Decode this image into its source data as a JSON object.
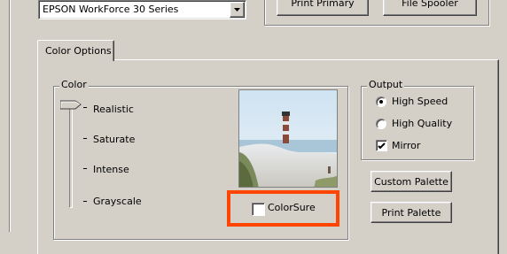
{
  "printer": {
    "selected": "EPSON WorkForce 30 Series"
  },
  "top_buttons": {
    "print_primary": "Print Primary",
    "file_spooler": "File Spooler"
  },
  "tab": {
    "label": "Color Options"
  },
  "color": {
    "legend": "Color",
    "levels": [
      "Realistic",
      "Saturate",
      "Intense",
      "Grayscale"
    ],
    "selected_level": "Realistic",
    "colorsure_label": "ColorSure",
    "colorsure_checked": false
  },
  "output": {
    "legend": "Output",
    "options": [
      "High Speed",
      "High Quality"
    ],
    "selected": "High Speed",
    "mirror_label": "Mirror",
    "mirror_checked": true
  },
  "buttons": {
    "custom_palette": "Custom Palette",
    "print_palette": "Print Palette"
  },
  "highlight_color": "#ff4500"
}
